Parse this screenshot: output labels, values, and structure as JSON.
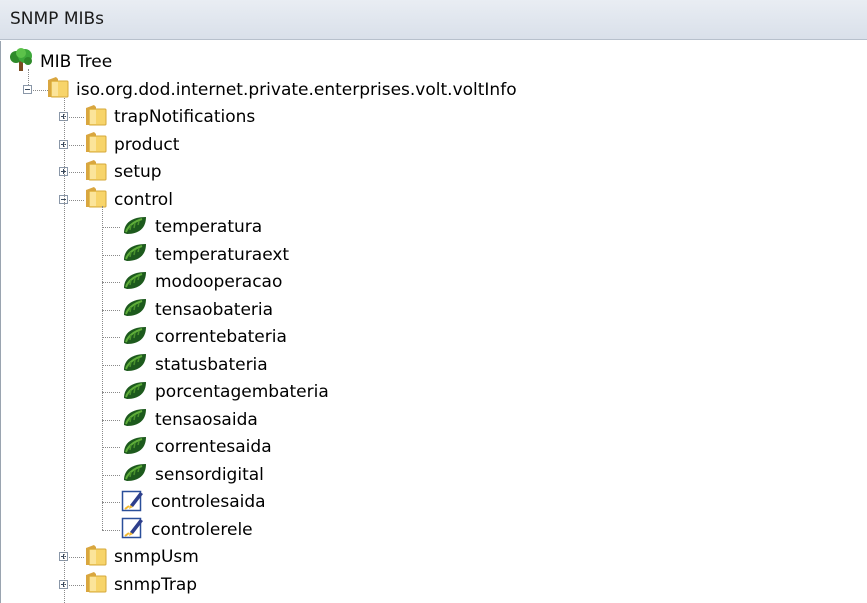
{
  "panel": {
    "title": "SNMP MIBs"
  },
  "tree": {
    "root": {
      "label": "MIB Tree"
    },
    "branch": {
      "label": "iso.org.dod.internet.private.enterprises.volt.voltInfo"
    },
    "folders_top": [
      {
        "label": "trapNotifications",
        "expanded": false
      },
      {
        "label": "product",
        "expanded": false
      },
      {
        "label": "setup",
        "expanded": false
      },
      {
        "label": "control",
        "expanded": true
      }
    ],
    "control_children": [
      {
        "label": "temperatura",
        "icon": "leaf-icon"
      },
      {
        "label": "temperaturaext",
        "icon": "leaf-icon"
      },
      {
        "label": "modooperacao",
        "icon": "leaf-icon"
      },
      {
        "label": "tensaobateria",
        "icon": "leaf-icon"
      },
      {
        "label": "correntebateria",
        "icon": "leaf-icon"
      },
      {
        "label": "statusbateria",
        "icon": "leaf-icon"
      },
      {
        "label": "porcentagembateria",
        "icon": "leaf-icon"
      },
      {
        "label": "tensaosaida",
        "icon": "leaf-icon"
      },
      {
        "label": "correntesaida",
        "icon": "leaf-icon"
      },
      {
        "label": "sensordigital",
        "icon": "leaf-icon"
      },
      {
        "label": "controlesaida",
        "icon": "writable-pen-icon"
      },
      {
        "label": "controlerele",
        "icon": "writable-pen-icon"
      }
    ],
    "folders_bottom": [
      {
        "label": "snmpUsm",
        "expanded": false
      },
      {
        "label": "snmpTrap",
        "expanded": false
      }
    ]
  }
}
